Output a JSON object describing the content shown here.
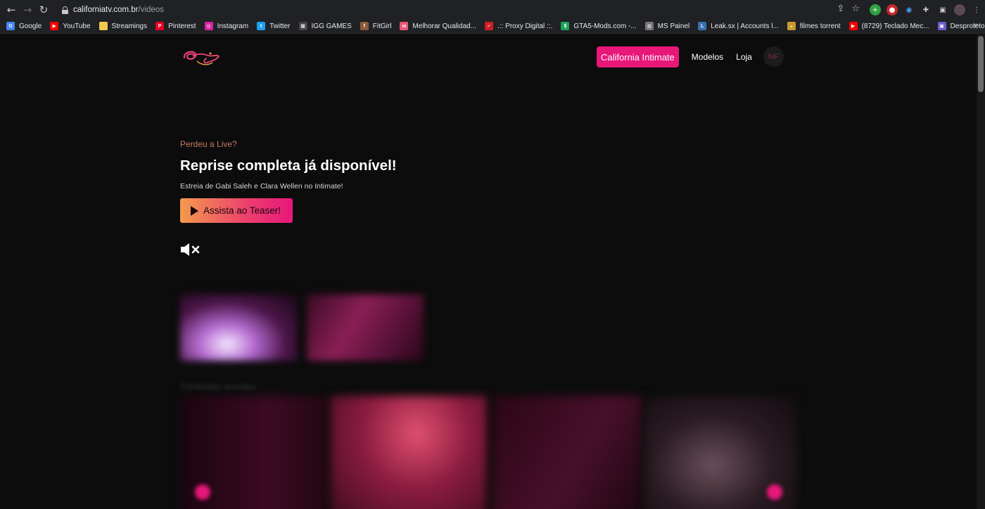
{
  "browser": {
    "url_domain": "californiatv.com.br",
    "url_path": "/videos",
    "bookmarks": [
      {
        "label": "Google",
        "color": "#4285f4",
        "glyph": "G"
      },
      {
        "label": "YouTube",
        "color": "#ff0000",
        "glyph": "▶"
      },
      {
        "label": "Streamings",
        "color": "#f2c94c",
        "glyph": ""
      },
      {
        "label": "Pinterest",
        "color": "#e60023",
        "glyph": "P"
      },
      {
        "label": "Instagram",
        "color": "#d6249f",
        "glyph": "◎"
      },
      {
        "label": "Twitter",
        "color": "#1da1f2",
        "glyph": "t"
      },
      {
        "label": "IGG GAMES",
        "color": "#444444",
        "glyph": "▦"
      },
      {
        "label": "FitGirl",
        "color": "#8a5a3c",
        "glyph": "f"
      },
      {
        "label": "Melhorar Qualidad...",
        "color": "#e8577a",
        "glyph": "w"
      },
      {
        "label": ".:: Proxy Digital ::.",
        "color": "#cc1f1f",
        "glyph": "✓"
      },
      {
        "label": "GTA5-Mods.com -...",
        "color": "#20a15a",
        "glyph": "$"
      },
      {
        "label": "MS Painel",
        "color": "#777777",
        "glyph": "◍"
      },
      {
        "label": "Leak.sx | Accounts l...",
        "color": "#3a6fb0",
        "glyph": "L"
      },
      {
        "label": "filmes torrent",
        "color": "#c99a2e",
        "glyph": "◒"
      },
      {
        "label": "(8729) Teclado Mec...",
        "color": "#ff0000",
        "glyph": "▶"
      },
      {
        "label": "Desprotetor.com |...",
        "color": "#6a5acd",
        "glyph": "▣"
      }
    ]
  },
  "site": {
    "nav": {
      "primary": "California Intimate",
      "links": [
        "Modelos",
        "Loja"
      ],
      "avatar_initials": "NF"
    },
    "hero": {
      "eyebrow": "Perdeu a Live?",
      "headline": "Reprise completa já disponível!",
      "subline": "Estreia de Gabi Saleh e Clara Wellen no Intimate!",
      "cta": "Assista ao Teaser!"
    },
    "colors": {
      "accent": "#e8177a",
      "cta_gradient_start": "#f39a4c",
      "eyebrow": "#c97a5e"
    }
  }
}
